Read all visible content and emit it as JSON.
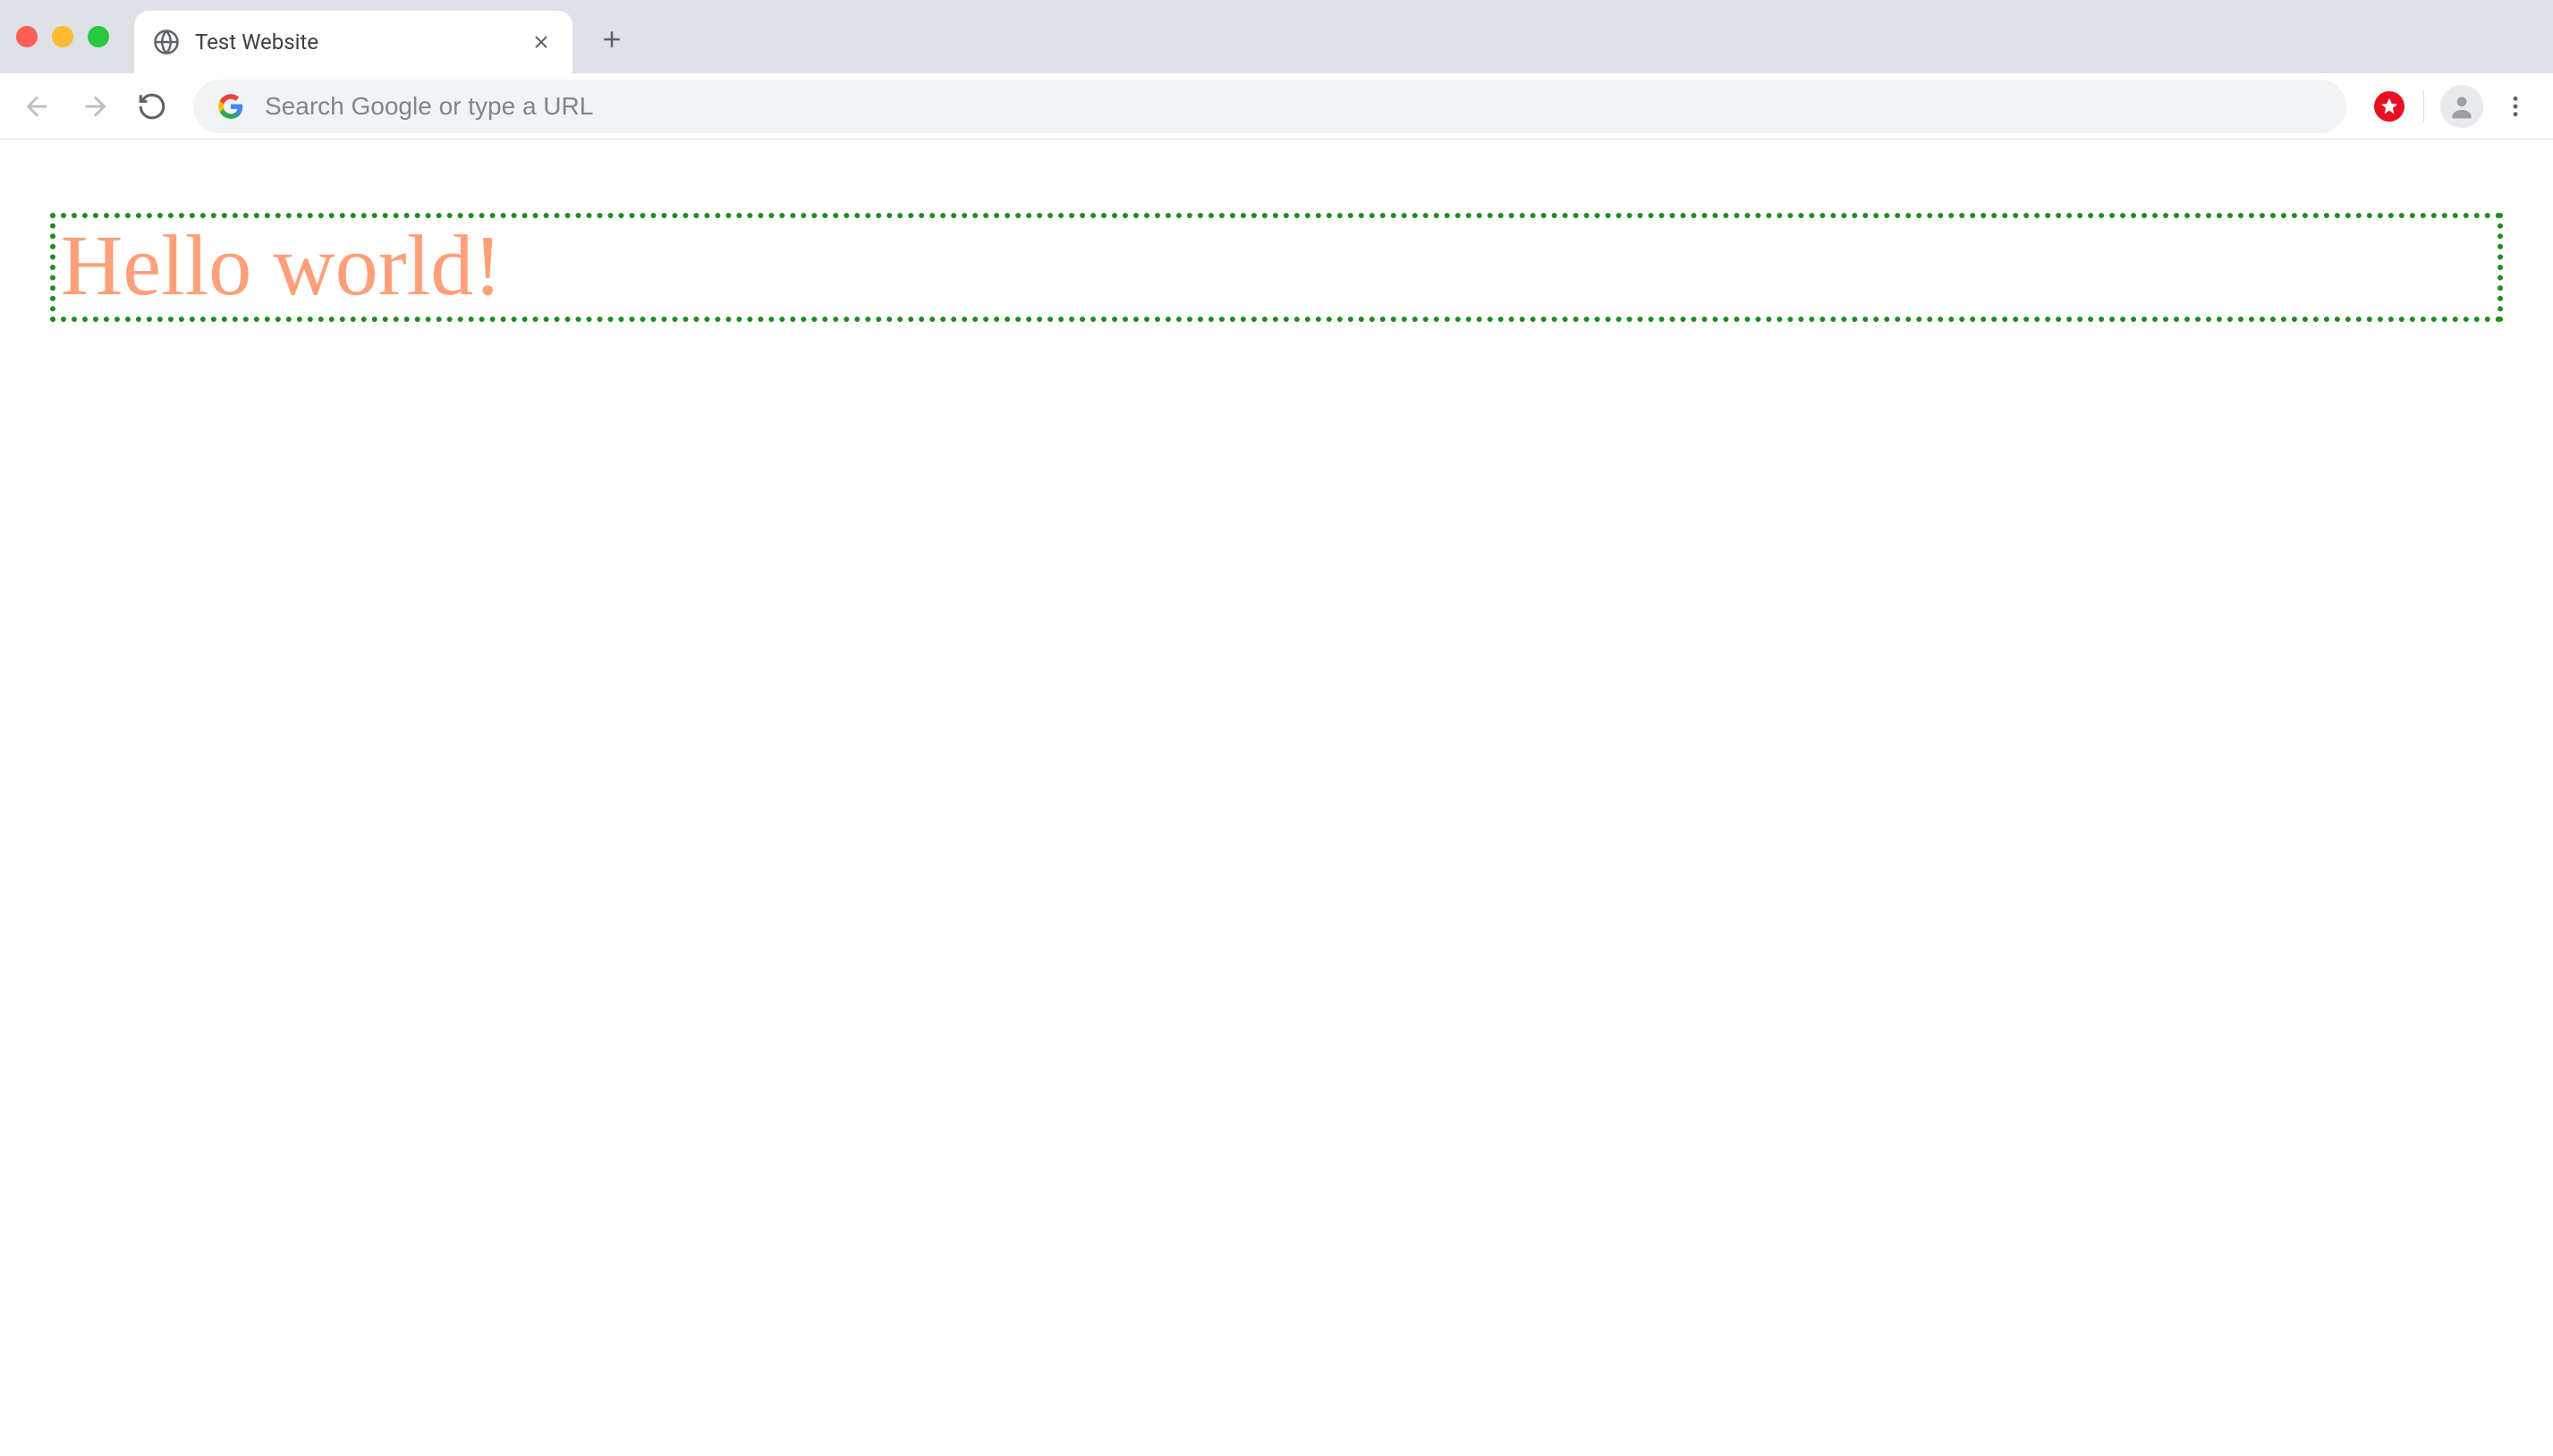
{
  "chrome": {
    "tab": {
      "title": "Test Website"
    },
    "omnibox": {
      "placeholder": "Search Google or type a URL",
      "value": ""
    }
  },
  "page": {
    "heading": "Hello world!"
  }
}
